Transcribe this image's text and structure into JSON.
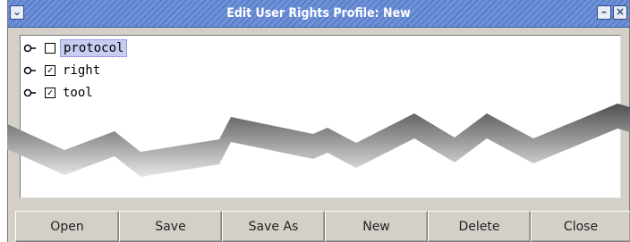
{
  "window": {
    "title": "Edit User Rights Profile: New"
  },
  "titlebar_buttons": {
    "menu_glyph": "⌄",
    "minimize_glyph": "–",
    "close_glyph": "×"
  },
  "tree": {
    "items": [
      {
        "label": "protocol",
        "checked": false,
        "check_glyph": "",
        "selected": true
      },
      {
        "label": "right",
        "checked": true,
        "check_glyph": "✓",
        "selected": false
      },
      {
        "label": "tool",
        "checked": true,
        "check_glyph": "✓",
        "selected": false
      }
    ]
  },
  "buttons": {
    "open": "Open",
    "save": "Save",
    "save_as": "Save As",
    "new": "New",
    "delete": "Delete",
    "close": "Close"
  },
  "colors": {
    "titlebar": "#6f92d8",
    "selection": "#c8ccf0"
  }
}
